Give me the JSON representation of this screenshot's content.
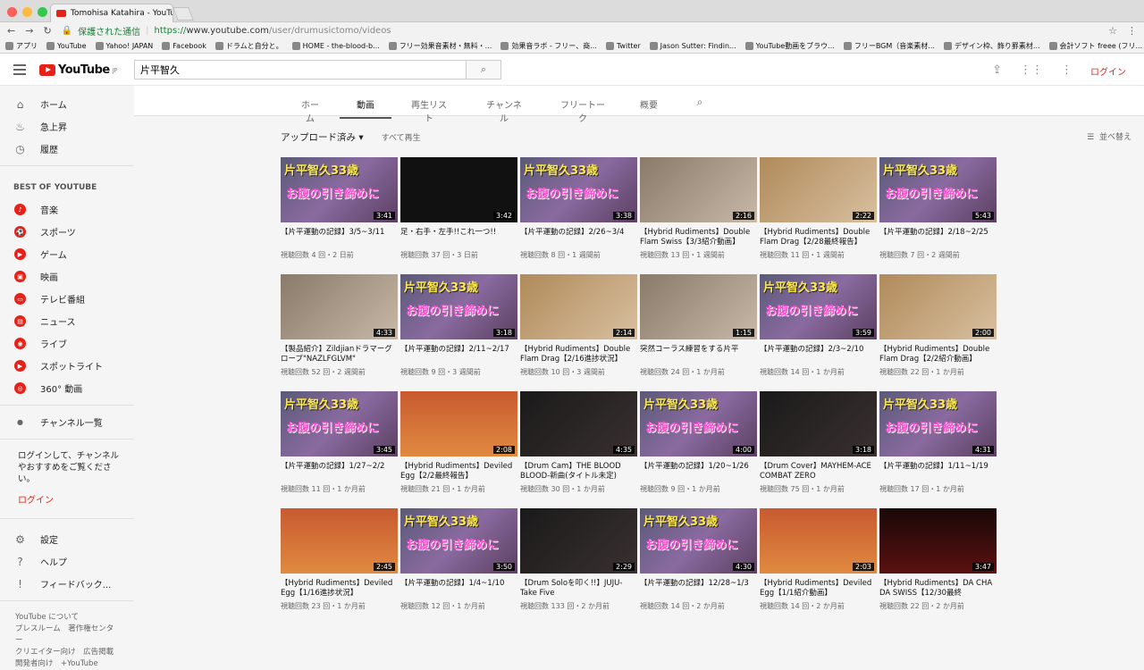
{
  "browser": {
    "tab_title": "Tomohisa Katahira - YouTube",
    "secure_label": "保護された通信",
    "url_scheme": "https://",
    "url_host": "www.youtube.com",
    "url_path": "/user/drumusictomo/videos"
  },
  "bookmarks": [
    "アプリ",
    "YouTube",
    "Yahoo! JAPAN",
    "Facebook",
    "ドラムと自分と。",
    "HOME - the-blood-b...",
    "フリー効果音素材・無料・...",
    "効果音ラボ - フリー、商...",
    "Twitter",
    "Jason Sutter: Findin...",
    "YouTube動画をブラウ...",
    "フリーBGM（音楽素材...",
    "デザイン枠、飾り罫素材...",
    "会計ソフト freee (フリ..."
  ],
  "header": {
    "logo": "YouTube",
    "region": "JP",
    "search_value": "片平智久",
    "login": "ログイン"
  },
  "sidebar": {
    "main": [
      "ホーム",
      "急上昇",
      "履歴"
    ],
    "best_head": "BEST OF YOUTUBE",
    "best": [
      "音楽",
      "スポーツ",
      "ゲーム",
      "映画",
      "テレビ番組",
      "ニュース",
      "ライブ",
      "スポットライト",
      "360° 動画"
    ],
    "channels": "チャンネル一覧",
    "login_text": "ログインして、チャンネルやおすすめをご覧ください。",
    "login": "ログイン",
    "settings": [
      "設定",
      "ヘルプ",
      "フィードバック..."
    ],
    "footer": [
      "YouTube について",
      "プレスルーム　著作権センター",
      "クリエイター向け　広告掲載",
      "開発者向け　+YouTube"
    ]
  },
  "channel_tabs": [
    "ホーム",
    "動画",
    "再生リスト",
    "チャンネル",
    "フリートーク",
    "概要"
  ],
  "filters": {
    "uploads": "アップロード済み",
    "play_all": "すべて再生",
    "sort": "並べ替え"
  },
  "thumb_text": {
    "a": "片平智久33歳",
    "b": "お腹の引き締めに"
  },
  "videos": [
    {
      "title": "【片平運動の記録】3/5~3/11",
      "meta": "視聴回数 4 回・2 日前",
      "dur": "3:41",
      "style": "a"
    },
    {
      "title": "足・右手・左手!!これ一つ!!",
      "meta": "視聴回数 37 回・3 日前",
      "dur": "3:42",
      "style": "c"
    },
    {
      "title": "【片平運動の記録】2/26~3/4",
      "meta": "視聴回数 8 回・1 週間前",
      "dur": "3:38",
      "style": "a"
    },
    {
      "title": "【Hybrid Rudiments】Double Flam Swiss【3/3紹介動画】",
      "meta": "視聴回数 13 回・1 週間前",
      "dur": "2:16",
      "style": "d"
    },
    {
      "title": "【Hybrid Rudiments】Double Flam Drag【2/28最終報告】",
      "meta": "視聴回数 11 回・1 週間前",
      "dur": "2:22",
      "style": "e"
    },
    {
      "title": "【片平運動の記録】2/18~2/25",
      "meta": "視聴回数 7 回・2 週間前",
      "dur": "5:43",
      "style": "a"
    },
    {
      "title": "【製品紹介】Zildjianドラマーグローブ\"NAZLFGLVM\"",
      "meta": "視聴回数 52 回・2 週間前",
      "dur": "4:33",
      "style": "d"
    },
    {
      "title": "【片平運動の記録】2/11~2/17",
      "meta": "視聴回数 9 回・3 週間前",
      "dur": "3:18",
      "style": "a"
    },
    {
      "title": "【Hybrid Rudiments】Double Flam Drag【2/16進捗状況】",
      "meta": "視聴回数 10 回・3 週間前",
      "dur": "2:14",
      "style": "e"
    },
    {
      "title": "突然コーラス練習をする片平",
      "meta": "視聴回数 24 回・1 か月前",
      "dur": "1:15",
      "style": "d"
    },
    {
      "title": "【片平運動の記録】2/3~2/10",
      "meta": "視聴回数 14 回・1 か月前",
      "dur": "3:59",
      "style": "a"
    },
    {
      "title": "【Hybrid Rudiments】Double Flam Drag【2/2紹介動画】",
      "meta": "視聴回数 22 回・1 か月前",
      "dur": "2:00",
      "style": "e"
    },
    {
      "title": "【片平運動の記録】1/27~2/2",
      "meta": "視聴回数 11 回・1 か月前",
      "dur": "3:45",
      "style": "a"
    },
    {
      "title": "【Hybrid Rudiments】Deviled Egg【2/2最終報告】",
      "meta": "視聴回数 21 回・1 か月前",
      "dur": "2:08",
      "style": "f"
    },
    {
      "title": "【Drum Cam】THE BLOOD BLOOD-新曲(タイトル未定)",
      "meta": "視聴回数 30 回・1 か月前",
      "dur": "4:35",
      "style": "g"
    },
    {
      "title": "【片平運動の記録】1/20~1/26",
      "meta": "視聴回数 9 回・1 か月前",
      "dur": "4:00",
      "style": "a"
    },
    {
      "title": "【Drum Cover】MAYHEM-ACE COMBAT ZERO",
      "meta": "視聴回数 75 回・1 か月前",
      "dur": "3:18",
      "style": "g"
    },
    {
      "title": "【片平運動の記録】1/11~1/19",
      "meta": "視聴回数 17 回・1 か月前",
      "dur": "4:31",
      "style": "a"
    },
    {
      "title": "【Hybrid Rudiments】Deviled Egg【1/16進捗状況】",
      "meta": "視聴回数 23 回・1 か月前",
      "dur": "2:45",
      "style": "f"
    },
    {
      "title": "【片平運動の記録】1/4~1/10",
      "meta": "視聴回数 12 回・1 か月前",
      "dur": "3:50",
      "style": "a"
    },
    {
      "title": "【Drum Soloを叩く!!】JUJU-Take Five",
      "meta": "視聴回数 133 回・2 か月前",
      "dur": "2:29",
      "style": "g"
    },
    {
      "title": "【片平運動の記録】12/28~1/3",
      "meta": "視聴回数 14 回・2 か月前",
      "dur": "4:30",
      "style": "a"
    },
    {
      "title": "【Hybrid Rudiments】Deviled Egg【1/1紹介動画】",
      "meta": "視聴回数 14 回・2 か月前",
      "dur": "2:03",
      "style": "f"
    },
    {
      "title": "【Hybrid Rudiments】DA CHA DA SWISS【12/30最終",
      "meta": "視聴回数 22 回・2 か月前",
      "dur": "3:47",
      "style": "h"
    }
  ]
}
